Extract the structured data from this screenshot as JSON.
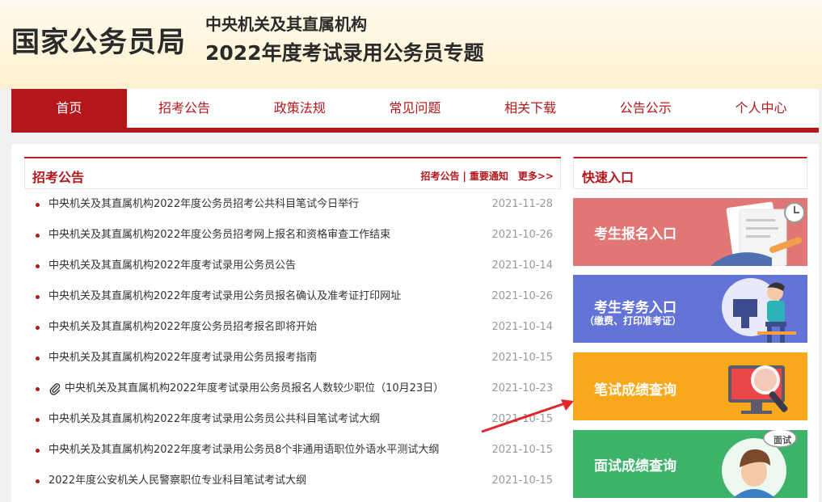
{
  "header": {
    "site_name": "国家公务员局",
    "sub_title_1": "中央机关及其直属机构",
    "sub_title_2": "2022年度考试录用公务员专题"
  },
  "nav": {
    "items": [
      "首页",
      "招考公告",
      "政策法规",
      "常见问题",
      "相关下载",
      "公告公示",
      "个人中心"
    ],
    "active_index": 0
  },
  "notices": {
    "title": "招考公告",
    "link_1": "招考公告",
    "separator": "|",
    "link_2": "重要通知",
    "more": "更多>>",
    "items": [
      {
        "text": "中央机关及其直属机构2022年度公务员招考公共科目笔试今日举行",
        "date": "2021-11-28"
      },
      {
        "text": "中央机关及其直属机构2022年度公务员招考网上报名和资格审查工作结束",
        "date": "2021-10-26"
      },
      {
        "text": "中央机关及其直属机构2022年度考试录用公务员公告",
        "date": "2021-10-14"
      },
      {
        "text": "中央机关及其直属机构2022年度考试录用公务员报名确认及准考证打印网址",
        "date": "2021-10-26"
      },
      {
        "text": "中央机关及其直属机构2022年度公务员招考报名即将开始",
        "date": "2021-10-14"
      },
      {
        "text": "中央机关及其直属机构2022年度考试录用公务员报考指南",
        "date": "2021-10-15"
      },
      {
        "text": "中央机关及其直属机构2022年度考试录用公务员报名人数较少职位（10月23日）",
        "date": "2021-10-23"
      },
      {
        "text": "中央机关及其直属机构2022年度考试录用公务员公共科目笔试考试大纲",
        "date": "2021-10-15"
      },
      {
        "text": "中央机关及其直属机构2022年度考试录用公务员8个非通用语职位外语水平测试大纲",
        "date": "2021-10-15"
      },
      {
        "text": "2022年度公安机关人民警察职位专业科目笔试考试大纲",
        "date": "2021-10-15"
      }
    ]
  },
  "quick": {
    "title": "快速入口",
    "btn_1": "考生报名入口",
    "btn_2": "考生考务入口",
    "btn_2_sub": "（缴费、打印准考证）",
    "btn_3": "笔试成绩查询",
    "btn_4": "面试成绩查询",
    "btn_4_bubble": "面试"
  },
  "colors": {
    "brand_red": "#b3171b",
    "btn_1": "#e07774",
    "btn_2": "#6474d6",
    "btn_3": "#f7a91b",
    "btn_4": "#3db36a"
  }
}
